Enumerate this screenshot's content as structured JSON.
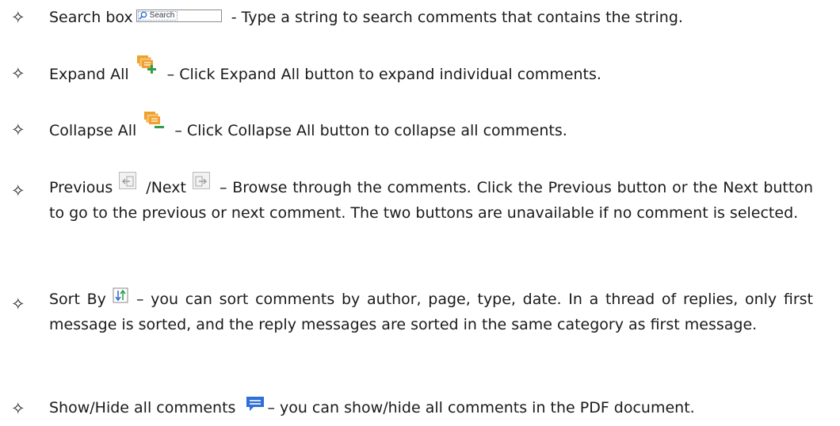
{
  "bullet": "✧",
  "items": [
    {
      "label": "Search box",
      "text": " - Type a string to search comments that contains the string.",
      "icon": "search-box-icon",
      "search_placeholder": "Search"
    },
    {
      "label": "Expand All",
      "text": "– Click Expand All button to expand individual comments.",
      "icon": "expand-all-icon"
    },
    {
      "label": "Collapse All",
      "text": "– Click Collapse All button to collapse all comments.",
      "icon": "collapse-all-icon"
    },
    {
      "label_previous": "Previous",
      "label_next": "/Next",
      "text": "– Browse through the comments. Click the Previous button or the Next button to go to the previous or next comment. The two buttons are unavailable if no comment is selected.",
      "icon_previous": "previous-icon",
      "icon_next": "next-icon"
    },
    {
      "label": "Sort By",
      "text": "– you can sort comments by author, page, type, date. In a thread of replies, only first message is sorted, and the reply messages are sorted in the same category as first message.",
      "icon": "sort-icon"
    },
    {
      "label": "Show/Hide all comments",
      "text": "– you can show/hide all comments in the PDF document.",
      "icon": "comment-bubble-icon"
    }
  ],
  "colors": {
    "orange": "#f0a030",
    "green": "#2e9e4a",
    "blue": "#2e6fd8",
    "grey": "#9a9a9a"
  }
}
